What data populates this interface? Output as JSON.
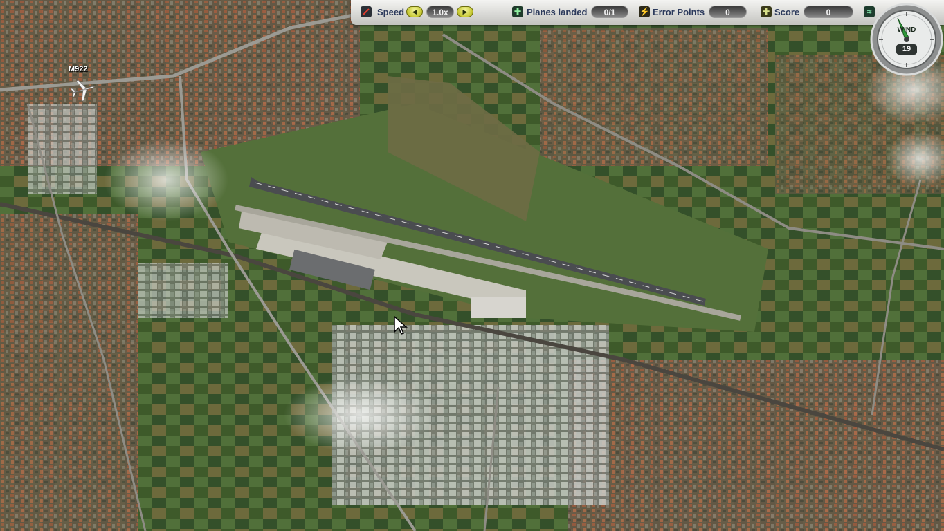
{
  "hud": {
    "speed_label": "Speed",
    "speed_value": "1.0x",
    "planes_landed_label": "Planes landed",
    "planes_landed_value": "0/1",
    "error_points_label": "Error Points",
    "error_points_value": "0",
    "score_label": "Score",
    "score_value": "0"
  },
  "wind": {
    "label": "WIND",
    "value": "19"
  },
  "plane": {
    "callsign": "M922"
  },
  "colors": {
    "hud_label": "#2c3a5c",
    "speed_button": "#c7c933",
    "field_background": "#555555"
  },
  "icons": {
    "speed": "speed-gauge-icon",
    "planes_landed": "plane-plus-icon",
    "error_points": "error-warning-icon",
    "score": "score-plus-icon",
    "settings": "wave-settings-icon"
  }
}
